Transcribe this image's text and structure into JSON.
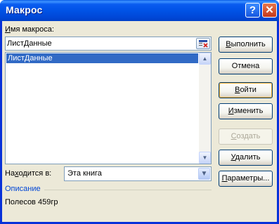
{
  "window": {
    "title": "Макрос",
    "help_glyph": "?",
    "close_glyph": "✕"
  },
  "macro_name": {
    "label_prefix": "",
    "label_underlined": "И",
    "label_rest": "мя макроса:",
    "value": "ЛистДанные"
  },
  "macro_list": {
    "items": [
      "ЛистДанные"
    ],
    "selected_index": 0
  },
  "buttons": {
    "run": {
      "u": "В",
      "rest": "ыполнить"
    },
    "cancel": "Отмена",
    "step_into": {
      "u": "В",
      "rest": "ойти"
    },
    "edit": {
      "u": "И",
      "rest": "зменить"
    },
    "create": {
      "u": "С",
      "rest": "оздать"
    },
    "delete": {
      "u": "У",
      "rest": "далить"
    },
    "options": {
      "u": "П",
      "rest": "араметры..."
    }
  },
  "location": {
    "label_pre": "На",
    "label_u": "х",
    "label_rest": "одится в:",
    "value": "Эта книга"
  },
  "description": {
    "title": "Описание",
    "text": "Полесов 459гр"
  },
  "colors": {
    "titlebar": "#0054e3",
    "selection": "#316ac5",
    "description_heading": "#0046d5"
  }
}
